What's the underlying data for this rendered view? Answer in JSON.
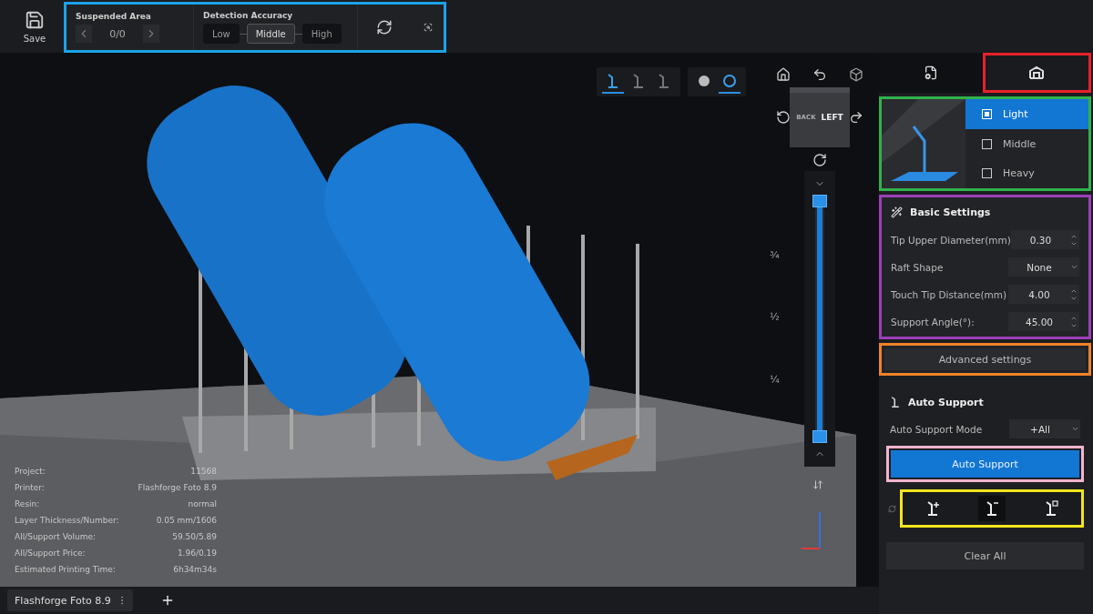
{
  "toolbar": {
    "save_label": "Save",
    "suspended_area": {
      "label": "Suspended Area",
      "count": "0/0"
    },
    "detection_accuracy": {
      "label": "Detection Accuracy",
      "options": [
        {
          "label": "Low",
          "selected": false
        },
        {
          "label": "Middle",
          "selected": true
        },
        {
          "label": "High",
          "selected": false
        }
      ]
    }
  },
  "viewport": {
    "support_view_modes": [
      {
        "selected": true
      },
      {
        "selected": false
      },
      {
        "selected": false
      }
    ],
    "render_modes": [
      {
        "selected": false
      },
      {
        "selected": true
      }
    ],
    "view_cube": {
      "faces": [
        "BACK",
        "LEFT"
      ]
    },
    "layer_slider": {
      "level": 1,
      "ticks": [
        "¾",
        "½",
        "¼"
      ]
    },
    "info": [
      {
        "label": "Project:",
        "value": "11568"
      },
      {
        "label": "Printer:",
        "value": "Flashforge Foto 8.9"
      },
      {
        "label": "Resin:",
        "value": "normal"
      },
      {
        "label": "Layer Thickness/Number:",
        "value": "0.05 mm/1606"
      },
      {
        "label": "All/Support Volume:",
        "value": "59.50/5.89"
      },
      {
        "label": "All/Support Price:",
        "value": "1.96/0.19"
      },
      {
        "label": "Estimated Printing Time:",
        "value": "6h34m34s"
      }
    ]
  },
  "panel": {
    "tabs": [
      {
        "selected": false
      },
      {
        "selected": true
      }
    ],
    "support_density": [
      {
        "label": "Light",
        "selected": true
      },
      {
        "label": "Middle",
        "selected": false
      },
      {
        "label": "Heavy",
        "selected": false
      }
    ],
    "basic_settings": {
      "title": "Basic Settings",
      "fields": [
        {
          "label": "Tip Upper Diameter(mm)",
          "value": "0.30",
          "kind": "spin"
        },
        {
          "label": "Raft Shape",
          "value": "None",
          "kind": "select"
        },
        {
          "label": "Touch Tip Distance(mm)",
          "value": "4.00",
          "kind": "spin"
        },
        {
          "label": "Support Angle(°):",
          "value": "45.00",
          "kind": "spin"
        }
      ]
    },
    "advanced_button": "Advanced settings",
    "auto_support": {
      "title": "Auto Support",
      "mode_label": "Auto Support Mode",
      "mode_value": "+All",
      "button": "Auto Support"
    },
    "support_tools": [
      {
        "kind": "add",
        "selected": false
      },
      {
        "kind": "remove",
        "selected": true
      },
      {
        "kind": "edit",
        "selected": false
      }
    ],
    "clear_button": "Clear All"
  },
  "bottom_bar": {
    "tabs": [
      {
        "label": "Flashforge Foto 8.9"
      }
    ]
  }
}
